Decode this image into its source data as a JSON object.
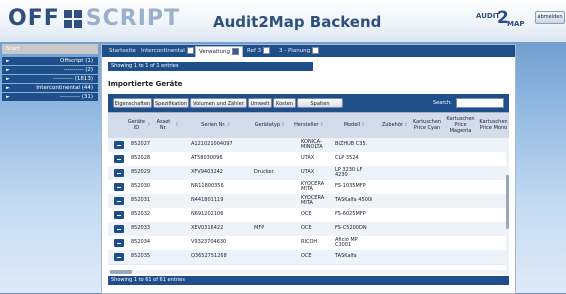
{
  "header": {
    "logo_off": "OFF",
    "logo_script": "SCRIPT",
    "app_title": "Audit2Map Backend",
    "audit_logo_audit": "AUDIT",
    "audit_logo_2": "2",
    "audit_logo_map": "MAP",
    "logout_label": "abmelden"
  },
  "sidebar": {
    "header": "Start",
    "items": [
      {
        "label": "Offscript (1)"
      },
      {
        "label": "---------- (2)"
      },
      {
        "label": "---------- (1813)"
      },
      {
        "label": "Intercontinental (44)"
      },
      {
        "label": "---------- (31)"
      }
    ]
  },
  "tabs": [
    {
      "label": "Startseite"
    },
    {
      "label": "Intercontinental"
    },
    {
      "label": "Verwaltung"
    },
    {
      "label": "Ref 3"
    },
    {
      "label": "3 - Planung"
    }
  ],
  "info_top": "Showing 1 to 1 of 1 entries",
  "section_title": "Importierte Geräte",
  "toolbar": {
    "buttons": [
      {
        "label": "Eigenschaften"
      },
      {
        "label": "Spezifikation"
      },
      {
        "label": "Volumen und Zähler"
      },
      {
        "label": "Umwelt"
      },
      {
        "label": "Kosten"
      },
      {
        "label": "Spalten anpassen"
      }
    ],
    "search_label": "Search:",
    "search_value": ""
  },
  "table": {
    "columns": [
      "",
      "Geräte ID",
      "Asset Nr.",
      "Serien Nr.",
      "Gerätetyp",
      "Hersteller",
      "Modell",
      "Zubehör",
      "Kartuschen Price Cyan",
      "Kartuschen Price Magenta",
      "Kartuschen Price Mono"
    ],
    "rows": [
      [
        "852027",
        "",
        "A121021004097",
        "",
        "KONICA-MINOLTA",
        "BIZHUB C35."
      ],
      [
        "852028",
        "",
        "AT58030096",
        "",
        "UTAX",
        "CLP 3524"
      ],
      [
        "852029",
        "",
        "XFV9403242",
        "Drucker",
        "UTAX",
        "LP 3230 LF 4230"
      ],
      [
        "852030",
        "",
        "NR11800356",
        "",
        "KYOCERA MITA",
        "FS-1035MFP"
      ],
      [
        "852031",
        "",
        "N441801119",
        "",
        "KYOCERA MITA",
        "TASKalfa 4500i"
      ],
      [
        "852032",
        "",
        "N691202106",
        "",
        "OCE",
        "FS-6025MFP"
      ],
      [
        "852033",
        "",
        "XEV0316422",
        "MFP",
        "OCE",
        "FS-C5200DN"
      ],
      [
        "852034",
        "",
        "V9323704630",
        "",
        "RICOH",
        "Aficio MP C3001"
      ],
      [
        "852035",
        "",
        "Q3652751268",
        "",
        "OCE",
        "TASKalfa"
      ]
    ]
  },
  "info_bottom": "Showing 1 to 61 of 61 entries"
}
